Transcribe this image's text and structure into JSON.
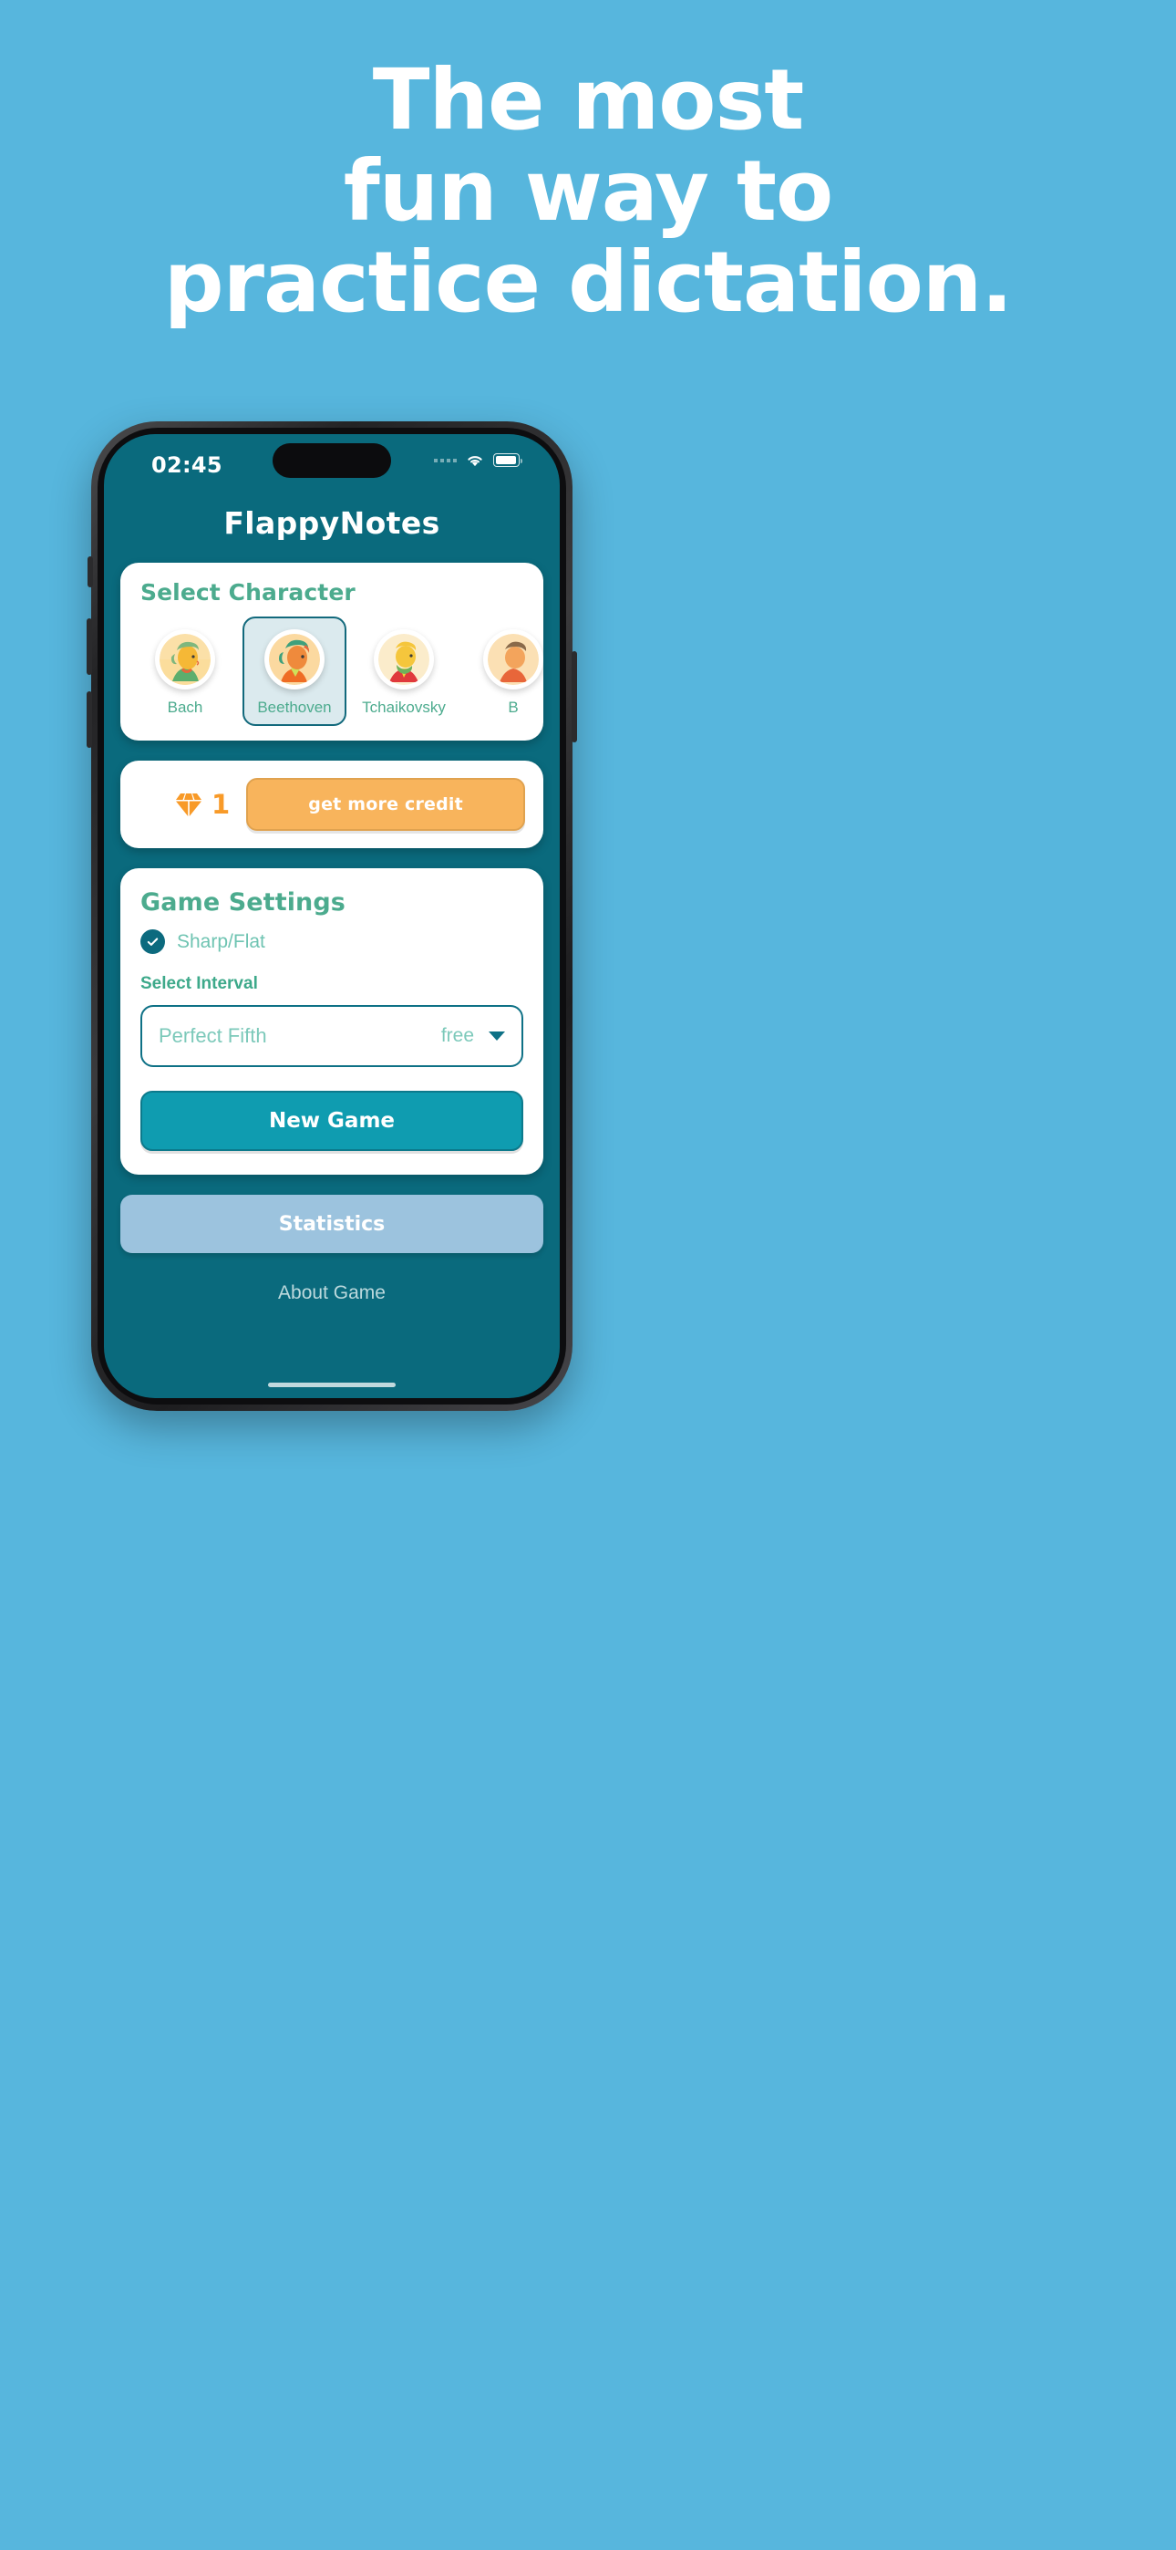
{
  "promo": {
    "background_color": "#57b6dd",
    "headline_lines": [
      "The most",
      "fun way to",
      "practice dictation."
    ]
  },
  "phone": {
    "status_bar": {
      "time": "02:45",
      "cellular_icon": "cellular-dots-icon",
      "wifi_icon": "wifi-icon",
      "battery_icon": "battery-icon"
    },
    "app": {
      "title": "FlappyNotes",
      "background_color": "#0a6a7d",
      "character_card": {
        "title": "Select Character",
        "accent_color": "#4cab8e",
        "selected": "Beethoven",
        "items": [
          {
            "name": "Bach",
            "selected": false
          },
          {
            "name": "Beethoven",
            "selected": true
          },
          {
            "name": "Tchaikovsky",
            "selected": false
          },
          {
            "name": "B",
            "selected": false
          }
        ]
      },
      "credit_card": {
        "gem_icon": "gem-icon",
        "count": "1",
        "button_label": "get more credit",
        "button_color": "#f8b45c"
      },
      "settings_card": {
        "title": "Game Settings",
        "sharp_flat_label": "Sharp/Flat",
        "sharp_flat_checked": true,
        "interval_label": "Select Interval",
        "interval_value": "Perfect Fifth",
        "interval_tag": "free",
        "caret_icon": "chevron-down-icon",
        "new_game_label": "New Game"
      },
      "statistics_label": "Statistics",
      "about_label": "About Game"
    }
  }
}
